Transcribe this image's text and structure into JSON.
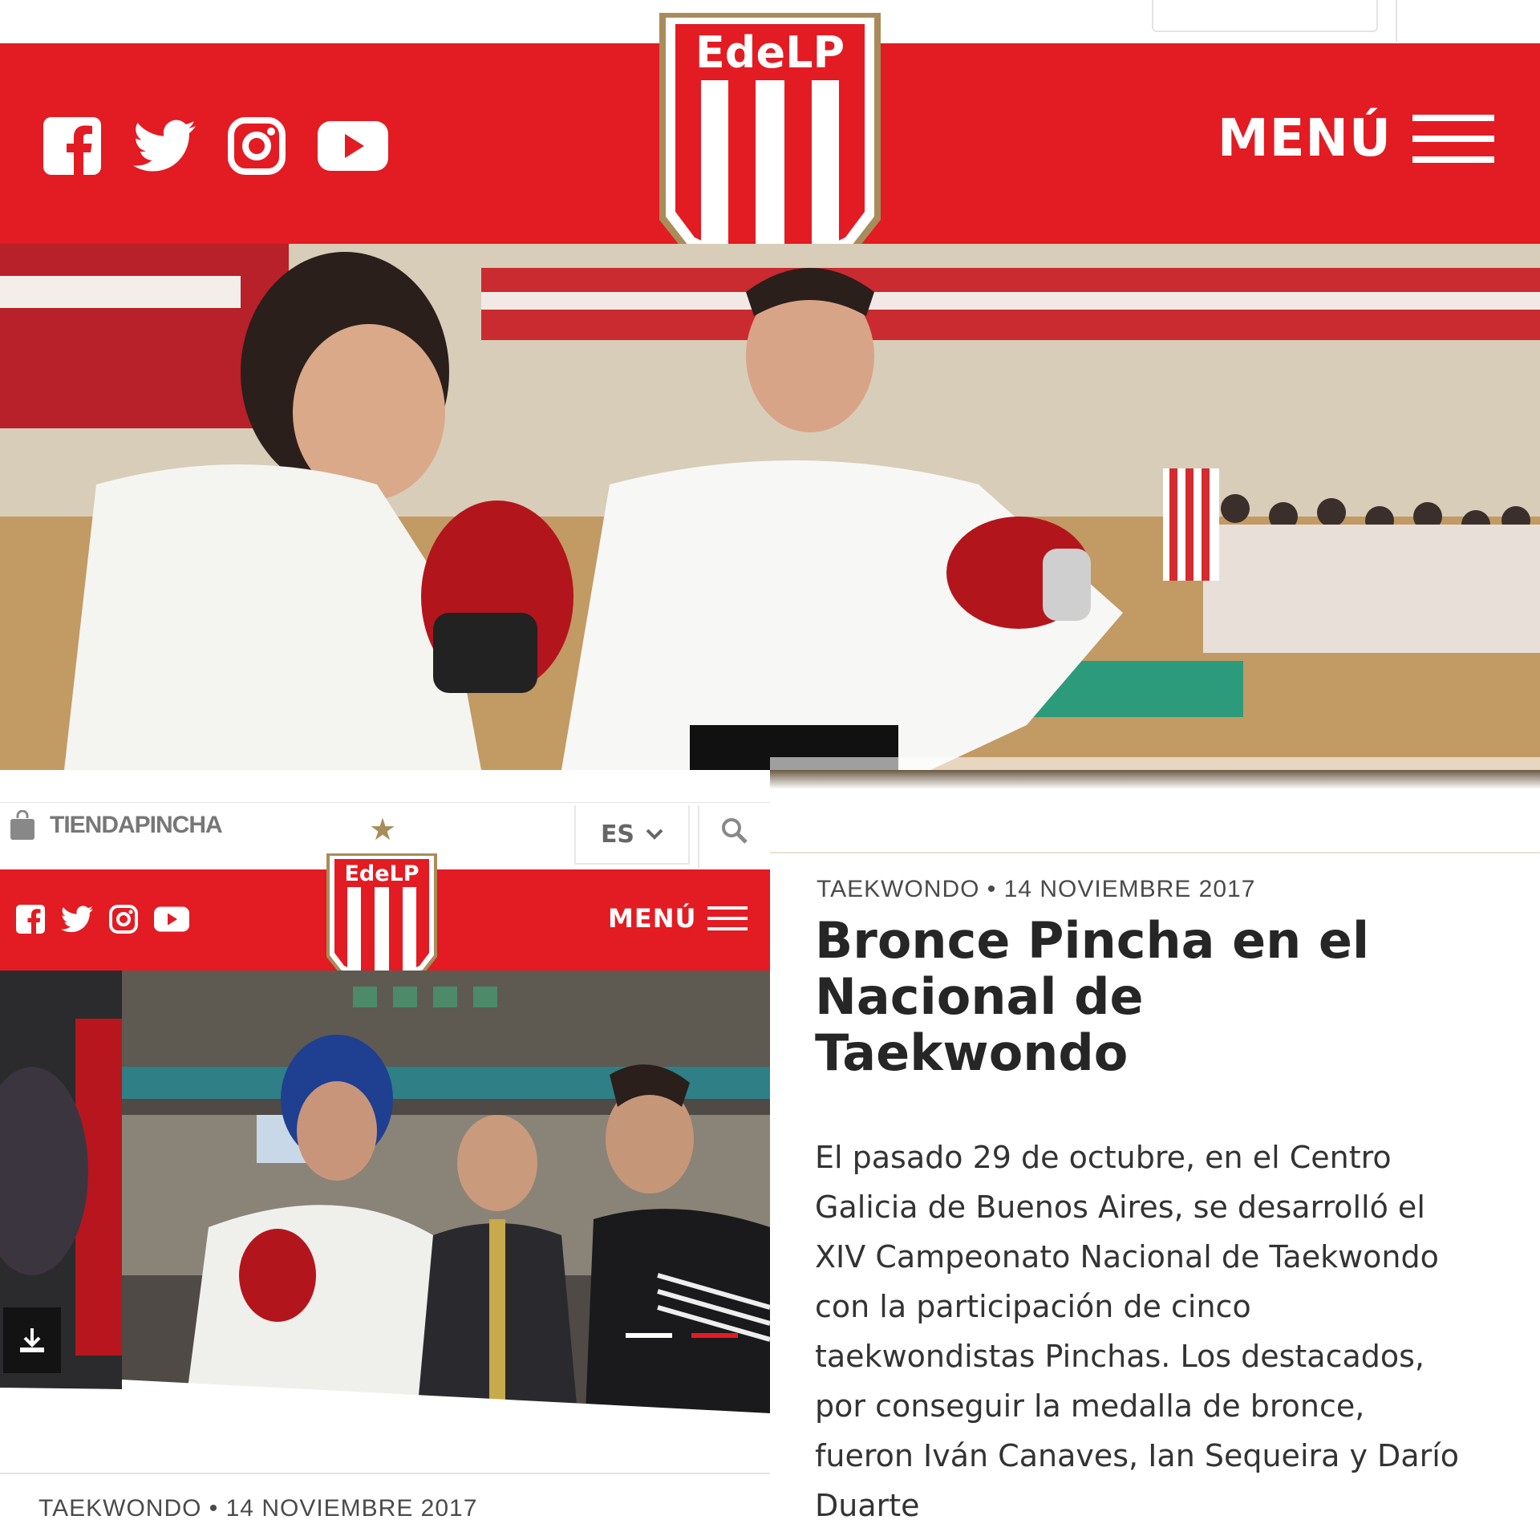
{
  "top": {
    "menu_label": "MENÚ",
    "logo_text": "EdeLP",
    "social": [
      "facebook-icon",
      "twitter-icon",
      "instagram-icon",
      "youtube-icon"
    ]
  },
  "store": {
    "label": "TIENDAPINCHA",
    "language": "ES"
  },
  "mobile": {
    "menu_label": "MENÚ",
    "logo_text": "EdeLP"
  },
  "article": {
    "meta": "TAEKWONDO • 14 NOVIEMBRE 2017",
    "title_lines": [
      "Bronce Pincha en el",
      "Nacional de",
      "Taekwondo"
    ],
    "body_lines": [
      "El pasado 29 de octubre, en el Centro",
      "Galicia de Buenos Aires, se desarrolló el",
      "XIV Campeonato Nacional de Taekwondo",
      "con la participación de cinco",
      "taekwondistas Pinchas. Los destacados,",
      "por conseguir la medalla de bronce,",
      "fueron Iván Canaves, Ian Sequeira y Darío",
      "Duarte"
    ]
  },
  "bottom_meta": "TAEKWONDO • 14 NOVIEMBRE 2017",
  "colors": {
    "brand_red": "#e31b23",
    "gold": "#a88c5a",
    "white": "#ffffff"
  }
}
